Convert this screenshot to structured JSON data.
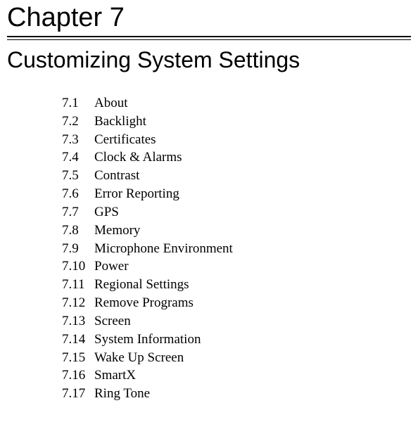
{
  "chapter": {
    "title": "Chapter 7",
    "subtitle": "Customizing System Settings"
  },
  "toc": [
    {
      "num": "7.1",
      "label": "About"
    },
    {
      "num": "7.2",
      "label": "Backlight"
    },
    {
      "num": "7.3",
      "label": "Certificates"
    },
    {
      "num": "7.4",
      "label": "Clock & Alarms"
    },
    {
      "num": "7.5",
      "label": "Contrast"
    },
    {
      "num": "7.6",
      "label": "Error Reporting"
    },
    {
      "num": "7.7",
      "label": "GPS"
    },
    {
      "num": "7.8",
      "label": "Memory"
    },
    {
      "num": "7.9",
      "label": "Microphone Environment"
    },
    {
      "num": "7.10",
      "label": "Power"
    },
    {
      "num": "7.11",
      "label": "Regional Settings"
    },
    {
      "num": "7.12",
      "label": "Remove Programs"
    },
    {
      "num": "7.13",
      "label": "Screen"
    },
    {
      "num": "7.14",
      "label": "System Information"
    },
    {
      "num": "7.15",
      "label": "Wake Up Screen"
    },
    {
      "num": "7.16",
      "label": "SmartX"
    },
    {
      "num": "7.17",
      "label": "Ring Tone"
    }
  ]
}
